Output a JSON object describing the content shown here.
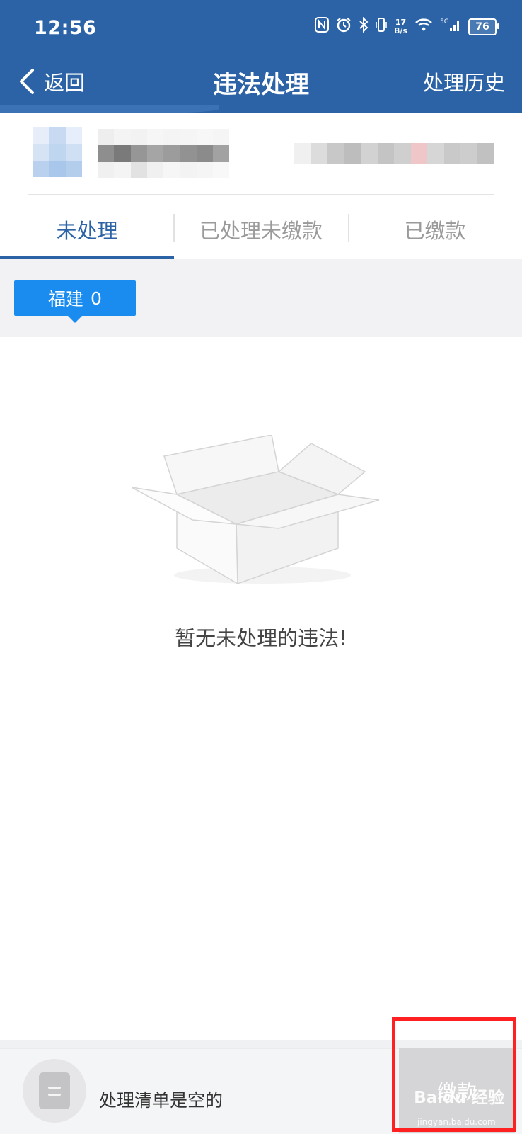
{
  "status_bar": {
    "time": "12:56",
    "net_speed_value": "17",
    "net_speed_unit": "B/s",
    "network": "5G",
    "battery": "76"
  },
  "nav": {
    "back_label": "返回",
    "title": "违法处理",
    "history_label": "处理历史"
  },
  "tabs": [
    {
      "label": "未处理",
      "active": true
    },
    {
      "label": "已处理未缴款",
      "active": false
    },
    {
      "label": "已缴款",
      "active": false
    }
  ],
  "province_filter": {
    "name": "福建",
    "count": "0"
  },
  "empty_state": {
    "message": "暂无未处理的违法!"
  },
  "bottom_bar": {
    "cart_status": "处理清单是空的",
    "pay_button": "缴款"
  },
  "watermark": {
    "text": "Baidu 经验",
    "sub": "jingyan.baidu.com"
  },
  "colors": {
    "brand": "#2b63a6",
    "chip": "#1a8cf0",
    "highlight": "#ff2121"
  }
}
